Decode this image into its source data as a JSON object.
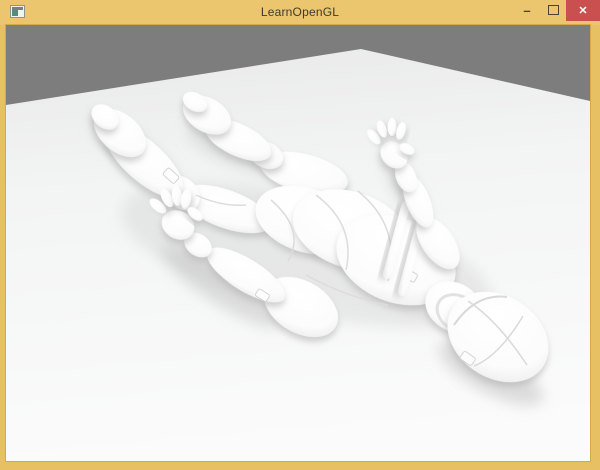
{
  "window": {
    "title": "LearnOpenGL",
    "app_icon": "glfw-window-icon",
    "controls": {
      "minimize_glyph": "–",
      "maximize_icon": "square-outline",
      "close_glyph": "✕"
    }
  },
  "scene": {
    "objects": {
      "background": "gray-void",
      "floor": "white-ground-plane",
      "model": "white-armored-figure-lying-on-back"
    },
    "colors": {
      "titlebar": "#ebc66e",
      "window_border": "#e7c063",
      "close_button": "#c9504e",
      "close_glyph": "#ffffff",
      "background": "#7d7d7d",
      "floor": "#f2f3f3",
      "model": "#ffffff",
      "contact_shadow": "#bfbfbf"
    }
  }
}
